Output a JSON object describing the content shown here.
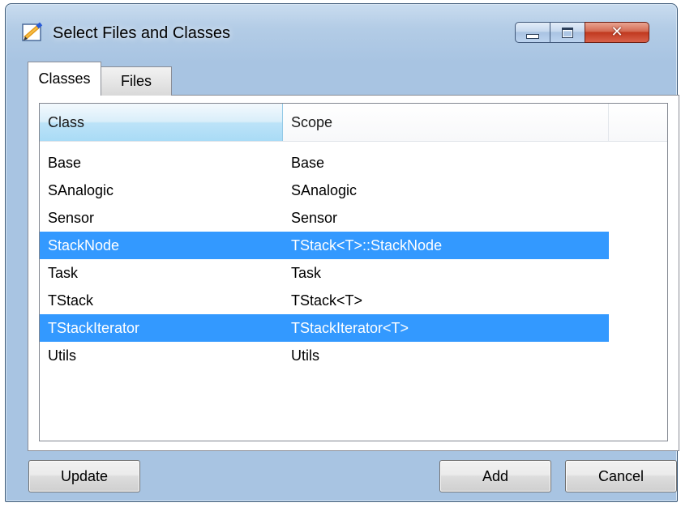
{
  "window": {
    "title": "Select Files and Classes",
    "icon": "pencil-edit-icon"
  },
  "tabs": [
    {
      "label": "Classes",
      "active": true
    },
    {
      "label": "Files",
      "active": false
    }
  ],
  "list": {
    "columns": [
      "Class",
      "Scope",
      ""
    ],
    "rows": [
      {
        "class": "Base",
        "scope": "Base",
        "selected": false
      },
      {
        "class": "SAnalogic",
        "scope": "SAnalogic",
        "selected": false
      },
      {
        "class": "Sensor",
        "scope": "Sensor",
        "selected": false
      },
      {
        "class": "StackNode",
        "scope": "TStack<T>::StackNode",
        "selected": true
      },
      {
        "class": "Task",
        "scope": "Task",
        "selected": false
      },
      {
        "class": "TStack",
        "scope": "TStack<T>",
        "selected": false
      },
      {
        "class": "TStackIterator",
        "scope": "TStackIterator<T>",
        "selected": true
      },
      {
        "class": "Utils",
        "scope": "Utils",
        "selected": false
      }
    ]
  },
  "buttons": {
    "update": "Update",
    "add": "Add",
    "cancel": "Cancel"
  },
  "colors": {
    "selection": "#3399ff",
    "close_button": "#c0391f"
  }
}
